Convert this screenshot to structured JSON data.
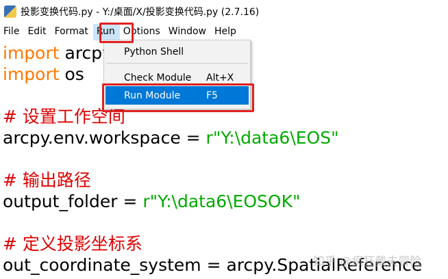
{
  "window": {
    "title": "投影变换代码.py - Y:/桌面/X/投影变换代码.py (2.7.16)",
    "icon": "python-file-icon"
  },
  "menu": [
    "File",
    "Edit",
    "Format",
    "Run",
    "Options",
    "Window",
    "Help"
  ],
  "run_menu": {
    "python_shell": "Python Shell",
    "check_module": "Check Module",
    "check_shortcut": "Alt+X",
    "run_module": "Run Module",
    "run_shortcut": "F5"
  },
  "code": {
    "l1kw": "import",
    "l1": " arcpy",
    "l2kw": "import",
    "l2": " os",
    "c1": "# 设置工作空间",
    "l3": "arcpy.env.workspace = ",
    "l3s": "r\"Y:\\data6\\EOS\"",
    "c2": "# 输出路径",
    "l4": "output_folder = ",
    "l4s": "r\"Y:\\data6\\EOSOK\"",
    "c3": "# 定义投影坐标系",
    "l5": "out_coordinate_system = arcpy.SpatialReference"
  },
  "watermark": "知乎 @疯狂戴夫冒险"
}
